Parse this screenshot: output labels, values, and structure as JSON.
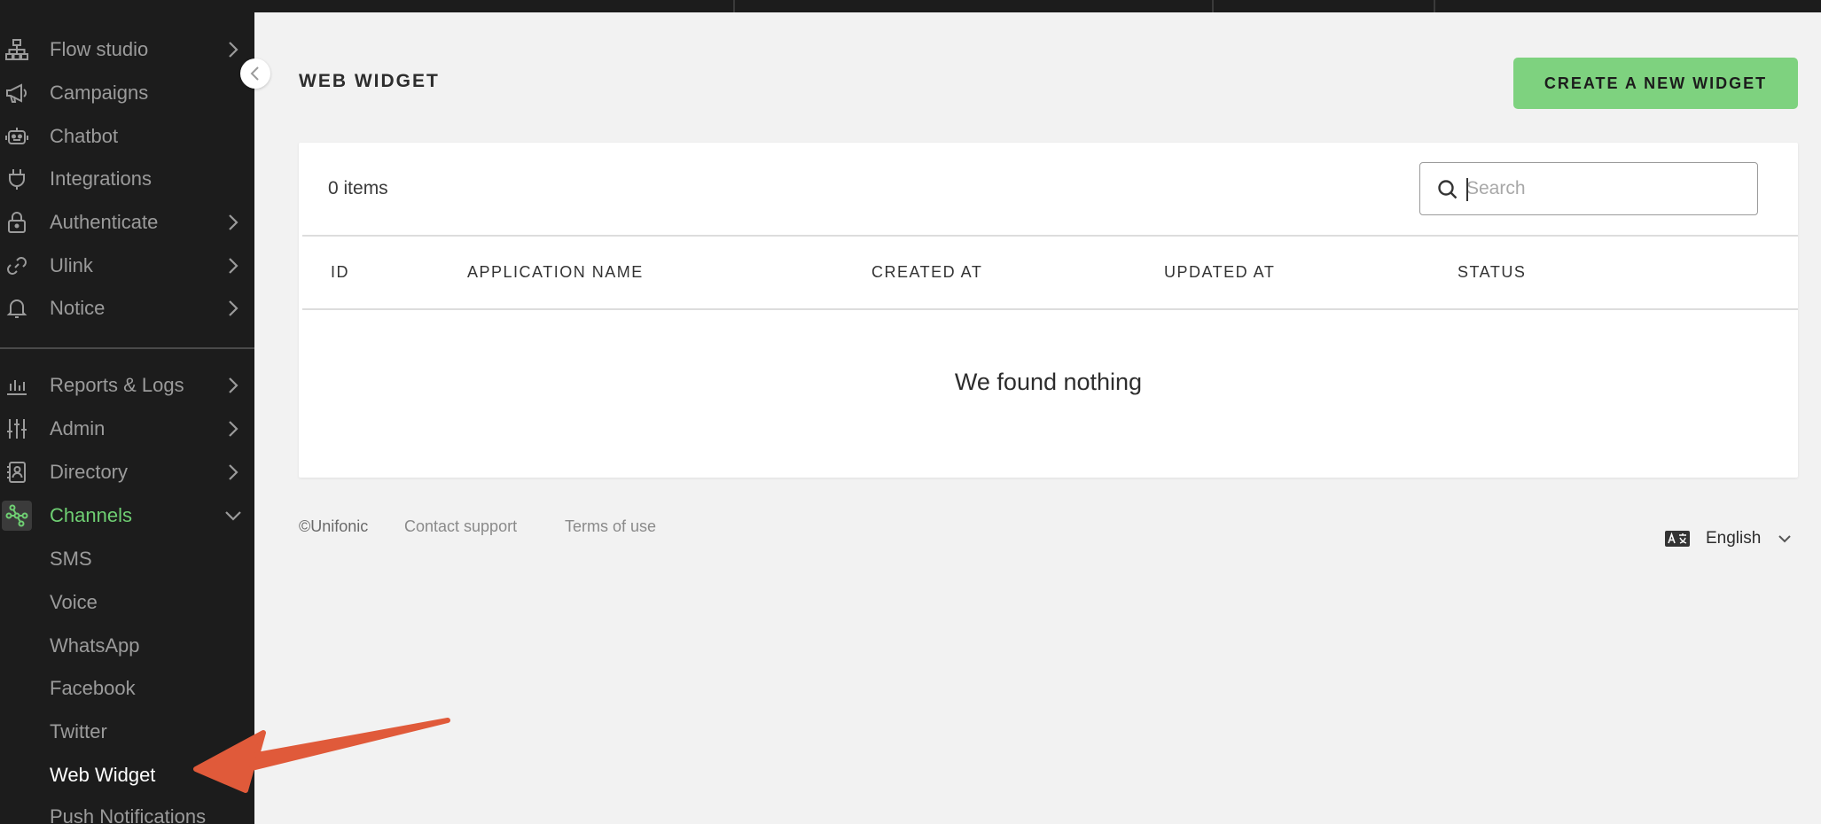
{
  "sidebar": {
    "items": [
      {
        "label": "Flow studio",
        "icon": "sitemap-icon",
        "has_chevron": true
      },
      {
        "label": "Campaigns",
        "icon": "megaphone-icon",
        "has_chevron": false
      },
      {
        "label": "Chatbot",
        "icon": "robot-icon",
        "has_chevron": false
      },
      {
        "label": "Integrations",
        "icon": "plug-icon",
        "has_chevron": false
      },
      {
        "label": "Authenticate",
        "icon": "lock-icon",
        "has_chevron": true
      },
      {
        "label": "Ulink",
        "icon": "link-icon",
        "has_chevron": true
      },
      {
        "label": "Notice",
        "icon": "bell-icon",
        "has_chevron": true
      },
      {
        "label": "Reports & Logs",
        "icon": "bar-chart-icon",
        "has_chevron": true
      },
      {
        "label": "Admin",
        "icon": "sliders-icon",
        "has_chevron": true
      },
      {
        "label": "Directory",
        "icon": "contact-book-icon",
        "has_chevron": true
      },
      {
        "label": "Channels",
        "icon": "channels-icon",
        "has_chevron": true,
        "expanded": true,
        "active": true
      }
    ],
    "channels_sub": [
      "SMS",
      "Voice",
      "WhatsApp",
      "Facebook",
      "Twitter",
      "Web Widget",
      "Push Notifications"
    ],
    "current_sub": "Web Widget"
  },
  "header": {
    "title": "WEB WIDGET",
    "create_label": "CREATE A NEW WIDGET"
  },
  "table": {
    "items_count": "0 items",
    "search_placeholder": "Search",
    "columns": [
      "ID",
      "APPLICATION NAME",
      "CREATED AT",
      "UPDATED AT",
      "STATUS"
    ],
    "empty_message": "We found nothing"
  },
  "footer": {
    "copyright": "©Unifonic",
    "contact": "Contact support",
    "terms": "Terms of use",
    "language": "English"
  },
  "colors": {
    "sidebar_bg": "#1c1c1c",
    "accent_green": "#7ed27f",
    "active_nav": "#6fcf73",
    "annotation_arrow": "#e05a3a"
  }
}
